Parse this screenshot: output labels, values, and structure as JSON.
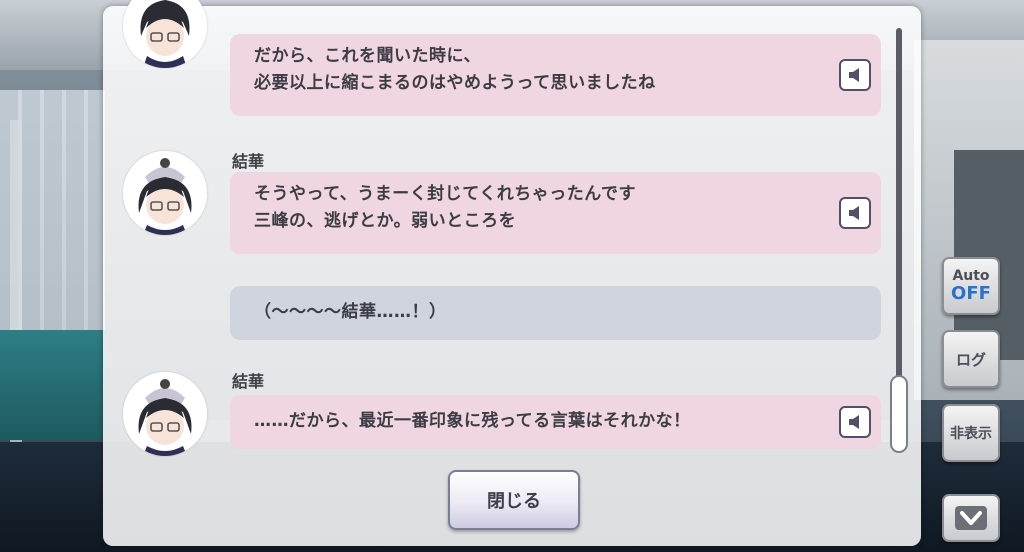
{
  "log": {
    "entries": [
      {
        "speaker": "",
        "type": "voiced",
        "lines": [
          "だから、これを聞いた時に、",
          "必要以上に縮こまるのはやめようって思いましたね"
        ]
      },
      {
        "speaker": "結華",
        "type": "voiced",
        "lines": [
          "そうやって、うまーく封じてくれちゃったんです",
          "三峰の、逃げとか。弱いところを"
        ]
      },
      {
        "speaker": "",
        "type": "narration",
        "lines": [
          "（～～～～結華……！）"
        ]
      },
      {
        "speaker": "結華",
        "type": "voiced",
        "lines": [
          "……だから、最近一番印象に残ってる言葉はそれかな！"
        ]
      }
    ],
    "close_label": "閉じる",
    "voice_icon": "speaker-icon",
    "scroll_position": 0.95
  },
  "controls": {
    "auto_label": "Auto",
    "auto_state": "OFF",
    "log_label": "ログ",
    "hide_label": "非表示",
    "down_icon": "chevron-down-icon"
  },
  "colors": {
    "bubble_speech": "#efd6e0",
    "bubble_narration": "#cfd4de",
    "auto_off": "#2a72c9"
  }
}
